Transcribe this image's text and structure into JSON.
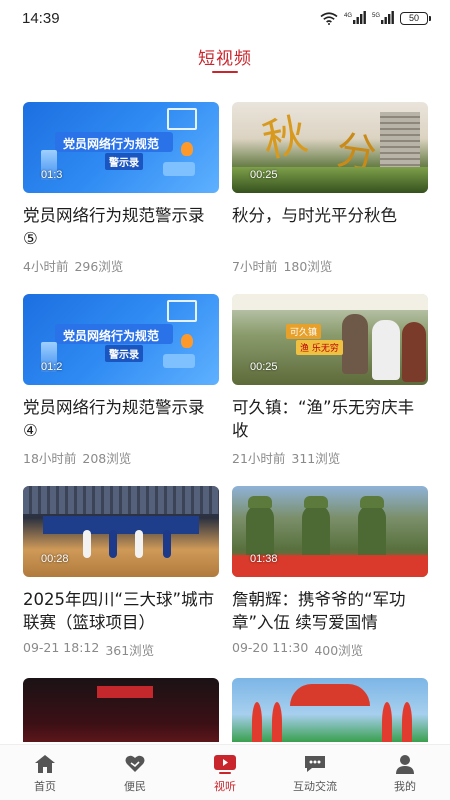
{
  "status_bar": {
    "time": "14:39",
    "network_label": "4G",
    "battery": "50"
  },
  "header": {
    "title": "短视频"
  },
  "videos": [
    {
      "title": "党员网络行为规范警示录⑤",
      "duration": "01:3",
      "time_ago": "4小时前",
      "views": "296浏览",
      "thumb_banner": "党员网络行为规范",
      "thumb_sub": "警示录"
    },
    {
      "title": "秋分，与时光平分秋色",
      "duration": "00:25",
      "time_ago": "7小时前",
      "views": "180浏览",
      "thumb_text_1": "秋",
      "thumb_text_2": "分"
    },
    {
      "title": "党员网络行为规范警示录④",
      "duration": "01:2",
      "time_ago": "18小时前",
      "views": "208浏览",
      "thumb_banner": "党员网络行为规范",
      "thumb_sub": "警示录"
    },
    {
      "title": "可久镇：“渔”乐无穷庆丰收",
      "duration": "00:25",
      "time_ago": "21小时前",
      "views": "311浏览",
      "thumb_tag_1": "可久镇",
      "thumb_tag_2": "渔 乐无穷"
    },
    {
      "title": "2025年四川“三大球”城市联赛（篮球项目）",
      "duration": "00:28",
      "time_ago": "09-21 18:12",
      "views": "361浏览"
    },
    {
      "title": "詹朝辉：携爷爷的“军功章”入伍 续写爱国情",
      "duration": "01:38",
      "time_ago": "09-20 11:30",
      "views": "400浏览"
    },
    {
      "title": "",
      "duration": "",
      "time_ago": "",
      "views": ""
    },
    {
      "title": "",
      "duration": "",
      "time_ago": "",
      "views": ""
    }
  ],
  "tabbar": {
    "items": [
      {
        "label": "首页",
        "icon": "home-icon"
      },
      {
        "label": "便民",
        "icon": "heart-hand-icon"
      },
      {
        "label": "视听",
        "icon": "play-video-icon",
        "active": true
      },
      {
        "label": "互动交流",
        "icon": "chat-icon"
      },
      {
        "label": "我的",
        "icon": "user-icon"
      }
    ]
  },
  "colors": {
    "accent": "#c8262c",
    "meta_text": "#8a8a8a",
    "tab_inactive": "#555555"
  }
}
